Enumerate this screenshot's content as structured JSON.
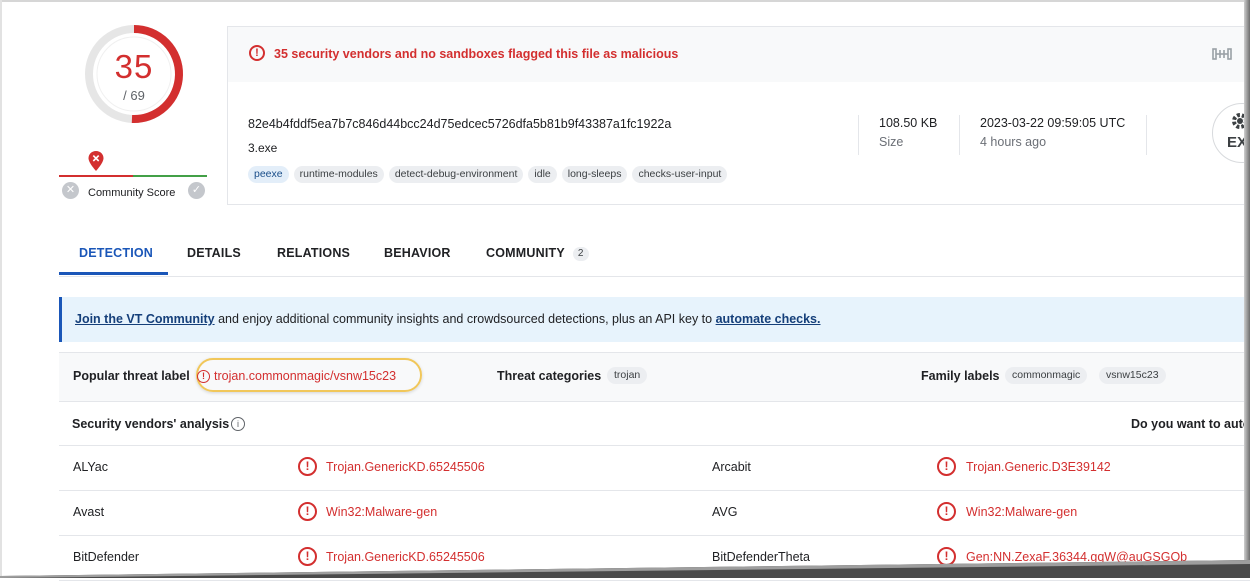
{
  "score": {
    "detections": "35",
    "total": "/ 69"
  },
  "community": {
    "label": "Community Score"
  },
  "summary": {
    "alert": "35 security vendors and no sandboxes flagged this file as malicious",
    "hash": "82e4b4fddf5ea7b7c846d44bcc24d75edcec5726dfa5b81b9f43387a1fc1922a",
    "filename": "3.exe",
    "tags": [
      "peexe",
      "runtime-modules",
      "detect-debug-environment",
      "idle",
      "long-sleeps",
      "checks-user-input"
    ],
    "size_value": "108.50 KB",
    "size_label": "Size",
    "date_value": "2023-03-22 09:59:05 UTC",
    "date_label": "4 hours ago",
    "file_type": "EXE"
  },
  "tabs": [
    {
      "label": "DETECTION"
    },
    {
      "label": "DETAILS"
    },
    {
      "label": "RELATIONS"
    },
    {
      "label": "BEHAVIOR"
    },
    {
      "label": "COMMUNITY",
      "badge": "2"
    }
  ],
  "banner": {
    "link1": "Join the VT Community",
    "middle": " and enjoy additional community insights and crowdsourced detections, plus an API key to ",
    "link2": "automate checks."
  },
  "threat": {
    "popular_label": "Popular threat label",
    "popular_value": "trojan.commonmagic/vsnw15c23",
    "categories_label": "Threat categories",
    "categories": [
      "trojan"
    ],
    "family_label": "Family labels",
    "families": [
      "commonmagic",
      "vsnw15c23"
    ]
  },
  "vendors": {
    "title": "Security vendors' analysis",
    "cta": "Do you want to autor",
    "rows": [
      {
        "left_name": "ALYac",
        "left_result": "Trojan.GenericKD.65245506",
        "right_name": "Arcabit",
        "right_result": "Trojan.Generic.D3E39142"
      },
      {
        "left_name": "Avast",
        "left_result": "Win32:Malware-gen",
        "right_name": "AVG",
        "right_result": "Win32:Malware-gen"
      },
      {
        "left_name": "BitDefender",
        "left_result": "Trojan.GenericKD.65245506",
        "right_name": "BitDefenderTheta",
        "right_result": "Gen:NN.ZexaF.36344.gqW@auGSGOb"
      }
    ]
  }
}
